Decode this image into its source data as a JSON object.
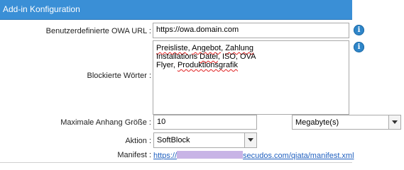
{
  "header": {
    "title": "Add-in Konfiguration"
  },
  "owa_url": {
    "label": "Benutzerdefinierte OWA URL :",
    "value": "https://owa.domain.com"
  },
  "blocked_words": {
    "label": "Blockierte Wörter :",
    "lines": [
      [
        {
          "t": "Preisliste",
          "sq": true
        },
        {
          "t": ", ",
          "sq": false
        },
        {
          "t": "Angebot",
          "sq": true
        },
        {
          "t": ", ",
          "sq": false
        },
        {
          "t": "Zahlung",
          "sq": true
        }
      ],
      [
        {
          "t": "Installations ",
          "sq": false
        },
        {
          "t": "Datei",
          "sq": true
        },
        {
          "t": ", ISO, OVA",
          "sq": false
        }
      ],
      [
        {
          "t": "Flyer, ",
          "sq": false
        },
        {
          "t": "Produktionsgrafik",
          "sq": true
        }
      ]
    ]
  },
  "max_attachment": {
    "label": "Maximale Anhang Größe :",
    "value": "10",
    "unit": "Megabyte(s)"
  },
  "action": {
    "label": "Aktion :",
    "value": "SoftBlock"
  },
  "manifest": {
    "label": "Manifest :",
    "prefix": "https://",
    "suffix": "secudos.com/qiata/manifest.xml"
  },
  "icons": {
    "info": "info-icon",
    "dropdown": "chevron-down-icon"
  },
  "colors": {
    "header_bg": "#3a8fd6",
    "link": "#1f5fbf",
    "info": "#2f86c9"
  }
}
